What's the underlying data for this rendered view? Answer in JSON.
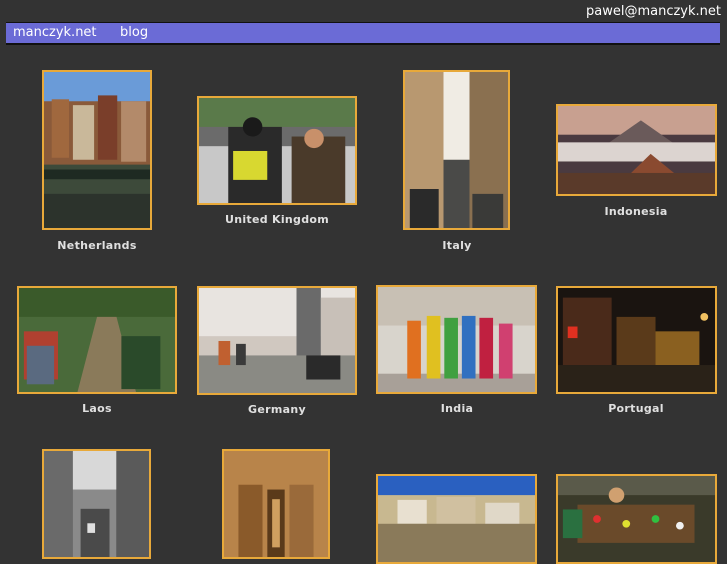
{
  "header": {
    "email": "pawel@manczyk.net"
  },
  "nav": {
    "items": [
      {
        "label": "manczyk.net"
      },
      {
        "label": "blog"
      }
    ]
  },
  "gallery": {
    "items": [
      {
        "caption": "Netherlands"
      },
      {
        "caption": "United Kingdom"
      },
      {
        "caption": "Italy"
      },
      {
        "caption": "Indonesia"
      },
      {
        "caption": "Laos"
      },
      {
        "caption": "Germany"
      },
      {
        "caption": "India"
      },
      {
        "caption": "Portugal"
      },
      {
        "caption": ""
      },
      {
        "caption": ""
      },
      {
        "caption": ""
      },
      {
        "caption": ""
      }
    ]
  },
  "colors": {
    "background": "#333333",
    "nav_bar": "#6b6bd6",
    "thumb_border": "#e8a93a"
  }
}
